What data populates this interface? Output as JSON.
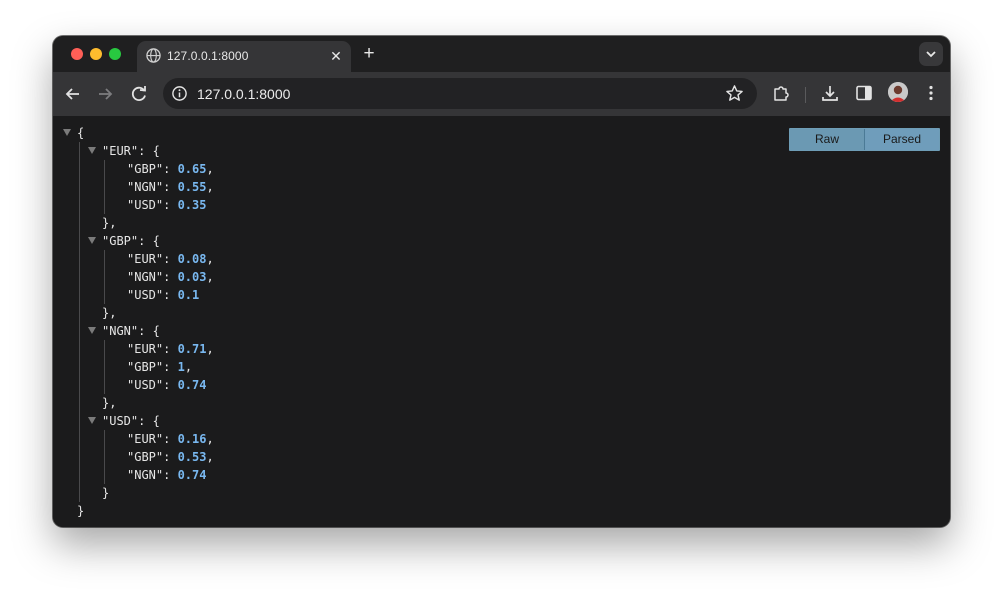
{
  "browser": {
    "tab": {
      "title": "127.0.0.1:8000"
    },
    "address_bar": {
      "url": "127.0.0.1:8000"
    }
  },
  "viewer_toggle": {
    "raw_label": "Raw",
    "parsed_label": "Parsed",
    "selected": "Parsed"
  },
  "json": {
    "open_brace": "{",
    "close_brace": "}",
    "groups": [
      {
        "key": "\"EUR\"",
        "items": [
          {
            "key": "\"GBP\"",
            "value": "0.65"
          },
          {
            "key": "\"NGN\"",
            "value": "0.55"
          },
          {
            "key": "\"USD\"",
            "value": "0.35"
          }
        ]
      },
      {
        "key": "\"GBP\"",
        "items": [
          {
            "key": "\"EUR\"",
            "value": "0.08"
          },
          {
            "key": "\"NGN\"",
            "value": "0.03"
          },
          {
            "key": "\"USD\"",
            "value": "0.1"
          }
        ]
      },
      {
        "key": "\"NGN\"",
        "items": [
          {
            "key": "\"EUR\"",
            "value": "0.71"
          },
          {
            "key": "\"GBP\"",
            "value": "1"
          },
          {
            "key": "\"USD\"",
            "value": "0.74"
          }
        ]
      },
      {
        "key": "\"USD\"",
        "items": [
          {
            "key": "\"EUR\"",
            "value": "0.16"
          },
          {
            "key": "\"GBP\"",
            "value": "0.53"
          },
          {
            "key": "\"NGN\"",
            "value": "0.74"
          }
        ]
      }
    ]
  },
  "colors": {
    "value_blue": "#79b8f0",
    "toggle_blue": "#6f9dbb"
  }
}
